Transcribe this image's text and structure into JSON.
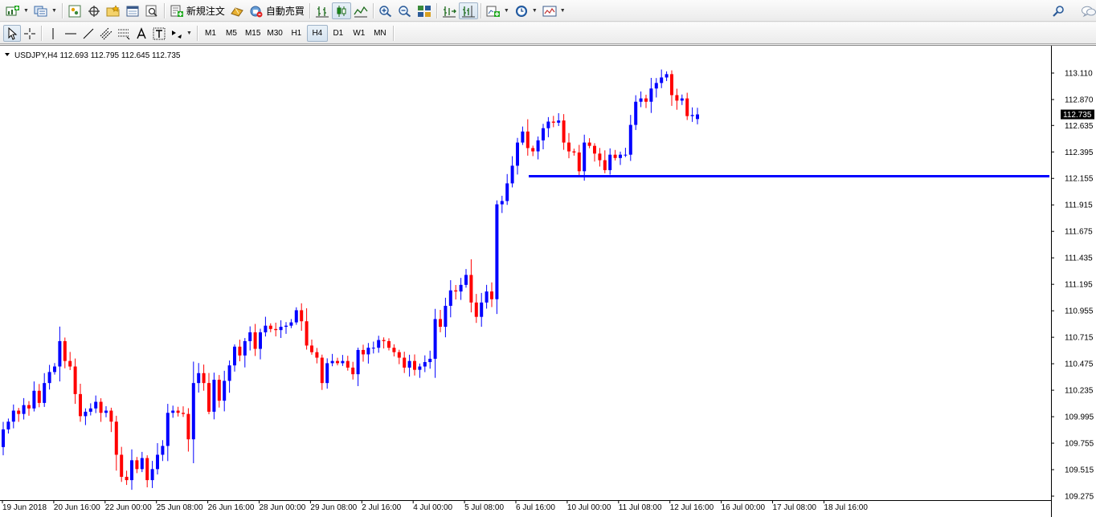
{
  "toolbar": {
    "new_order_label": "新規注文",
    "auto_trading_label": "自動売買"
  },
  "timeframes": [
    "M1",
    "M5",
    "M15",
    "M30",
    "H1",
    "H4",
    "D1",
    "W1",
    "MN"
  ],
  "active_timeframe": "H4",
  "chart_header": {
    "text": "USDJPY,H4  112.693 112.795 112.645 112.735"
  },
  "colors": {
    "bull": "#0000ff",
    "bear": "#ff0000",
    "hline": "#0000ff",
    "price_tag_bg": "#000000"
  },
  "chart_data": {
    "type": "candlestick",
    "symbol": "USDJPY",
    "timeframe": "H4",
    "ohlc_header": {
      "open": 112.693,
      "high": 112.795,
      "low": 112.645,
      "close": 112.735
    },
    "last_price": "112.735",
    "y_ticks": [
      "113.110",
      "112.870",
      "112.635",
      "112.395",
      "112.155",
      "111.915",
      "111.675",
      "111.435",
      "111.195",
      "110.955",
      "110.715",
      "110.475",
      "110.235",
      "109.995",
      "109.755",
      "109.515",
      "109.275"
    ],
    "ylim": [
      109.2,
      113.3
    ],
    "x_labels": [
      "19 Jun 2018",
      "20 Jun 16:00",
      "22 Jun 00:00",
      "25 Jun 08:00",
      "26 Jun 16:00",
      "28 Jun 00:00",
      "29 Jun 08:00",
      "2 Jul 16:00",
      "4 Jul 00:00",
      "5 Jul 08:00",
      "6 Jul 16:00",
      "10 Jul 00:00",
      "11 Jul 08:00",
      "12 Jul 16:00",
      "16 Jul 00:00",
      "17 Jul 08:00",
      "18 Jul 16:00"
    ],
    "horizontal_line": 112.175,
    "closes": [
      109.88,
      109.95,
      110.05,
      110.02,
      110.1,
      110.07,
      110.23,
      110.12,
      110.3,
      110.4,
      110.45,
      110.68,
      110.5,
      110.45,
      110.2,
      110.0,
      110.04,
      110.07,
      110.13,
      110.03,
      110.05,
      109.95,
      109.65,
      109.45,
      109.42,
      109.6,
      109.52,
      109.62,
      109.42,
      109.52,
      109.65,
      109.73,
      110.03,
      110.05,
      110.03,
      110.02,
      109.79,
      110.3,
      110.39,
      110.3,
      110.04,
      110.33,
      110.14,
      110.32,
      110.46,
      110.63,
      110.55,
      110.68,
      110.76,
      110.61,
      110.76,
      110.82,
      110.79,
      110.78,
      110.81,
      110.82,
      110.85,
      110.96,
      110.86,
      110.64,
      110.58,
      110.53,
      110.3,
      110.48,
      110.5,
      110.48,
      110.5,
      110.44,
      110.38,
      110.6,
      110.56,
      110.62,
      110.62,
      110.69,
      110.68,
      110.62,
      110.58,
      110.53,
      110.44,
      110.5,
      110.42,
      110.45,
      110.49,
      110.52,
      110.88,
      110.81,
      111.0,
      111.14,
      111.13,
      111.19,
      111.28,
      111.03,
      110.9,
      111.03,
      111.13,
      111.06,
      111.92,
      111.95,
      112.11,
      112.27,
      112.48,
      112.58,
      112.43,
      112.4,
      112.5,
      112.61,
      112.67,
      112.66,
      112.68,
      112.48,
      112.4,
      112.39,
      112.22,
      112.48,
      112.45,
      112.38,
      112.32,
      112.23,
      112.37,
      112.34,
      112.37,
      112.37,
      112.64,
      112.85,
      112.88,
      112.85,
      112.97,
      113.02,
      113.07,
      113.1,
      112.91,
      112.86,
      112.88,
      112.72,
      112.73,
      112.75
    ]
  }
}
